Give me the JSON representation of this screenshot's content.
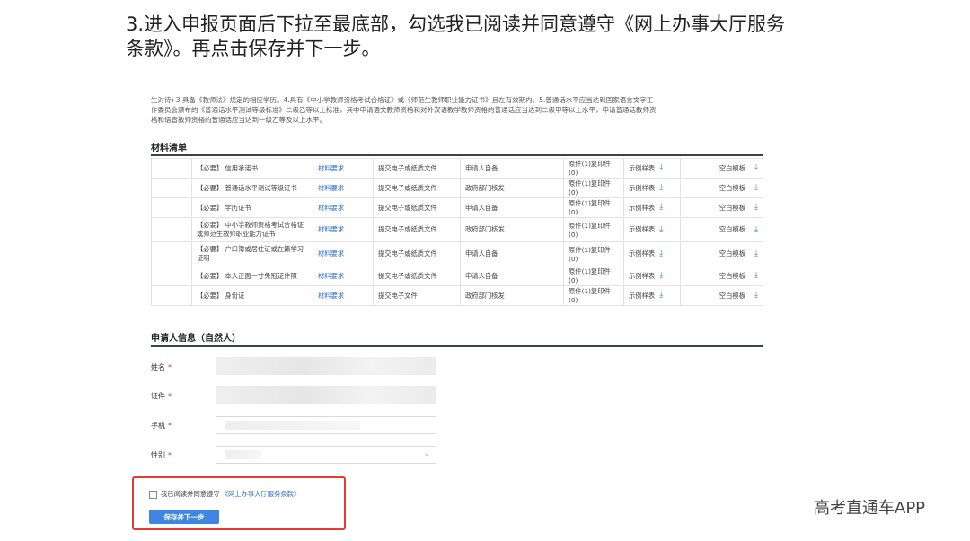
{
  "headline": {
    "line1": "3.进入申报页面后下拉至最底部，勾选我已阅读并同意遵守《网上办事大厅服务",
    "line2": "条款》。再点击保存并下一步。"
  },
  "intro": {
    "line1": "生对待) 3.具备《教师法》规定的相应学历。4.具有《中小学教师资格考试合格证》或《师范生教师职业能力证书》且在有效期内。5.普通话水平应当达到国家语言文字工",
    "line2": "作委员会颁布的《普通话水平测试等级标准》二级乙等以上标准，其中申请语文教师资格和对外汉语教学教师资格的普通话应当达到二级甲等以上水平，申请普通话教师资",
    "line3": "格和语音教师资格的普通话应当达到一级乙等及以上水平。"
  },
  "materials": {
    "title": "材料清单",
    "rows": [
      {
        "name": "【必要】 信用承诺书",
        "req": "材料要求",
        "submit": "提交电子或纸质文件",
        "source": "申请人自备",
        "copies": "原件(1)复印件(0)",
        "sample": "示例样表",
        "blank": "空白模板"
      },
      {
        "name": "【必要】 普通话水平测试等级证书",
        "req": "材料要求",
        "submit": "提交电子或纸质文件",
        "source": "政府部门核发",
        "copies": "原件(1)复印件(0)",
        "sample": "示例样表",
        "blank": "空白模板"
      },
      {
        "name": "【必要】 学历证书",
        "req": "材料要求",
        "submit": "提交电子或纸质文件",
        "source": "申请人自备",
        "copies": "原件(1)复印件(0)",
        "sample": "示例样表",
        "blank": "空白模板"
      },
      {
        "name": "【必要】 中小学教师资格考试合格证或师范生教师职业能力证书",
        "req": "材料要求",
        "submit": "提交电子或纸质文件",
        "source": "政府部门核发",
        "copies": "原件(1)复印件(0)",
        "sample": "示例样表",
        "blank": "空白模板"
      },
      {
        "name": "【必要】 户口簿或居住证或在籍学习证明",
        "req": "材料要求",
        "submit": "提交电子或纸质文件",
        "source": "申请人自备",
        "copies": "原件(1)复印件(0)",
        "sample": "示例样表",
        "blank": "空白模板"
      },
      {
        "name": "【必要】 本人正面一寸免冠证件照",
        "req": "材料要求",
        "submit": "提交电子或纸质文件",
        "source": "申请人自备",
        "copies": "原件(1)复印件(0)",
        "sample": "示例样表",
        "blank": "空白模板"
      },
      {
        "name": "【必要】 身份证",
        "req": "材料要求",
        "submit": "提交电子文件",
        "source": "政府部门核发",
        "copies": "原件(1)复印件(0)",
        "sample": "示例样表",
        "blank": "空白模板"
      }
    ]
  },
  "applicant": {
    "title": "申请人信息（自然人）",
    "name_label": "姓名",
    "id_label": "证件",
    "phone_label": "手机",
    "gender_label": "性别",
    "required_mark": "*"
  },
  "agreement": {
    "text": "我已阅读并同意遵守",
    "link": "《网上办事大厅服务条款》"
  },
  "save_button": "保存并下一步",
  "watermark": "高考直通车APP",
  "colors": {
    "link": "#2a6fc4",
    "button": "#3f86e2",
    "highlight": "#e63b33",
    "download_icon": "#2e9e3e"
  }
}
